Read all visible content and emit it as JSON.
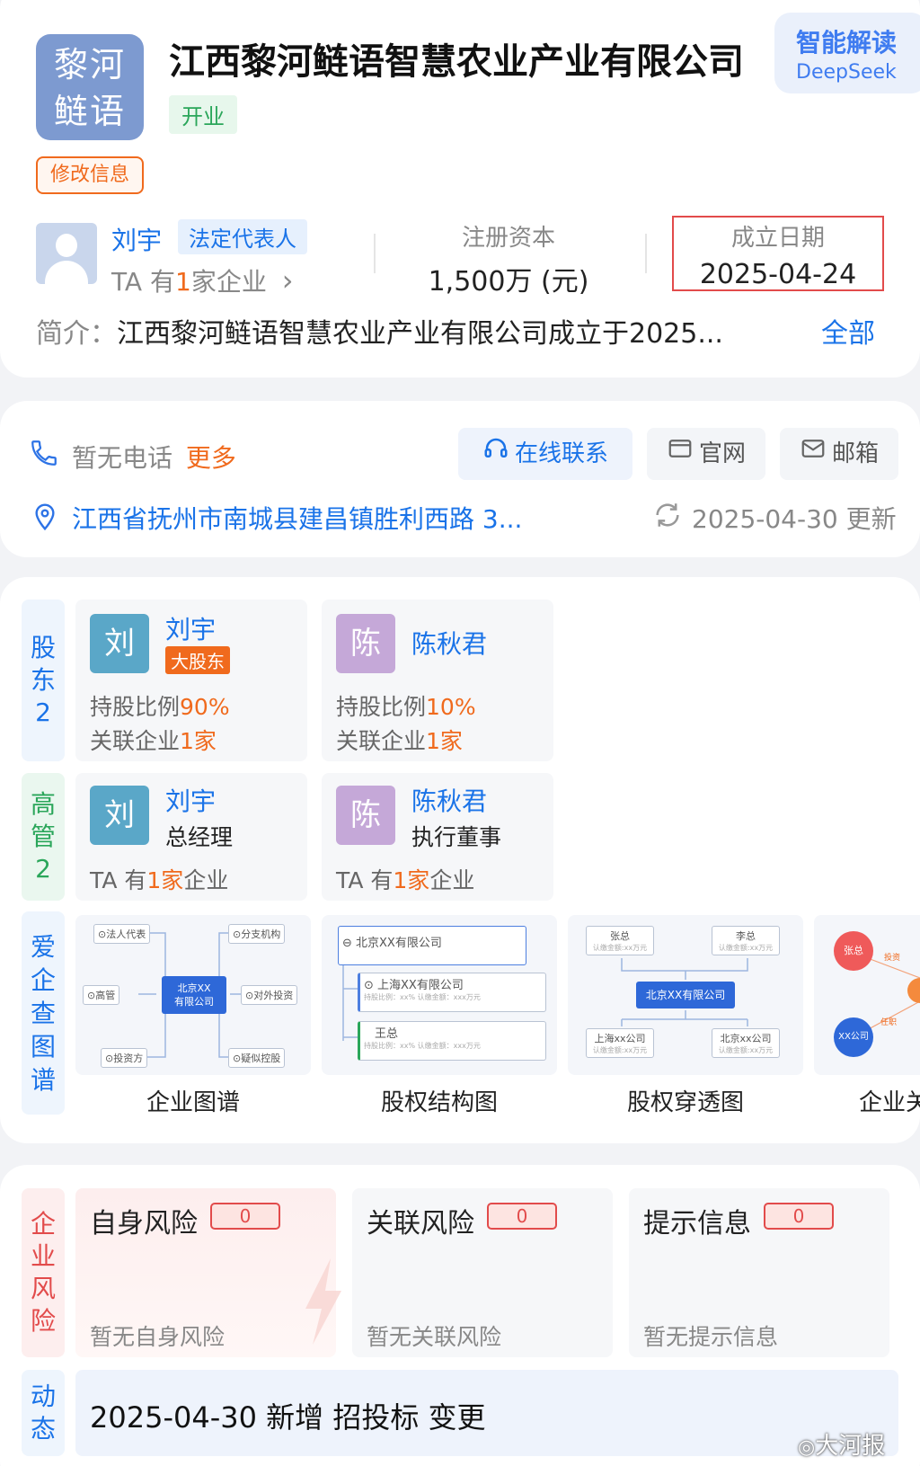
{
  "header": {
    "logo_line1": "黎河",
    "logo_line2": "鲢语",
    "company_name": "江西黎河鲢语智慧农业产业有限公司",
    "status": "开业",
    "edit_label": "修改信息",
    "ai_title": "智能解读",
    "ai_sub": "DeepSeek"
  },
  "legal": {
    "name": "刘宇",
    "tag": "法定代表人",
    "sub_prefix": "TA 有",
    "sub_count": "1",
    "sub_suffix": "家企业",
    "chevron": "›"
  },
  "capital": {
    "label": "注册资本",
    "value": "1,500万 (元)"
  },
  "founded": {
    "label": "成立日期",
    "value": "2025-04-24"
  },
  "intro": {
    "label": "简介：",
    "text": "江西黎河鲢语智慧农业产业有限公司成立于2025...",
    "all_label": "全部"
  },
  "contact": {
    "phone_text": "暂无电话",
    "more_label": "更多",
    "online_label": "在线联系",
    "website_label": "官网",
    "email_label": "邮箱",
    "address": "江西省抚州市南城县建昌镇胜利西路 3...",
    "updated": "2025-04-30 更新"
  },
  "shareholders": {
    "side": [
      "股",
      "东",
      "2"
    ],
    "items": [
      {
        "avatar": "刘",
        "name": "刘宇",
        "tag": "大股东",
        "ratio_label": "持股比例",
        "ratio": "90%",
        "rel_label": "关联企业",
        "rel_count": "1",
        "rel_unit": "家"
      },
      {
        "avatar": "陈",
        "name": "陈秋君",
        "ratio_label": "持股比例",
        "ratio": "10%",
        "rel_label": "关联企业",
        "rel_count": "1",
        "rel_unit": "家"
      }
    ]
  },
  "executives": {
    "side": [
      "高",
      "管",
      "2"
    ],
    "items": [
      {
        "avatar": "刘",
        "name": "刘宇",
        "role": "总经理",
        "sub_prefix": "TA 有",
        "sub_count": "1",
        "sub_mid": "家",
        "sub_suffix": "企业"
      },
      {
        "avatar": "陈",
        "name": "陈秋君",
        "role": "执行董事",
        "sub_prefix": "TA 有",
        "sub_count": "1",
        "sub_mid": "家",
        "sub_suffix": "企业"
      }
    ]
  },
  "graphs": {
    "side": [
      "爱",
      "企",
      "查",
      "图",
      "谱"
    ],
    "labels": [
      "企业图谱",
      "股权结构图",
      "股权穿透图",
      "企业关"
    ],
    "g1": {
      "legal": "⊙法人代表",
      "branch": "⊙分支机构",
      "exec": "⊙高管",
      "invest": "⊙对外投资",
      "investor": "⊙投资方",
      "control": "⊙疑似控股",
      "center1": "北京XX",
      "center2": "有限公司"
    },
    "g2": {
      "root": "⊖ 北京XX有限公司",
      "child1": "⊙ 上海XX有限公司",
      "child1_sub": "持股比例：xx%    认缴金额：xxx万元",
      "child2": "王总",
      "child2_sub": "持股比例：xx%    认缴金额：xxx万元"
    },
    "g3": {
      "top1": "张总",
      "top2": "李总",
      "top_sub": "认缴金额:xx万元",
      "center": "北京XX有限公司",
      "bot1": "上海xx公司",
      "bot2": "北京xx公司",
      "bot_sub": "认缴金额:xx万元"
    },
    "g4": {
      "node1": "张总",
      "node2": "XX公司",
      "edge1": "投资",
      "edge2": "任职"
    }
  },
  "risk": {
    "side": [
      "企",
      "业",
      "风",
      "险"
    ],
    "items": [
      {
        "title": "自身风险",
        "count": "0",
        "empty": "暂无自身风险"
      },
      {
        "title": "关联风险",
        "count": "0",
        "empty": "暂无关联风险"
      },
      {
        "title": "提示信息",
        "count": "0",
        "empty": "暂无提示信息"
      }
    ]
  },
  "dynamic": {
    "side": [
      "动",
      "态"
    ],
    "text": "2025-04-30 新增 招投标 变更"
  },
  "watermark": "大河报"
}
